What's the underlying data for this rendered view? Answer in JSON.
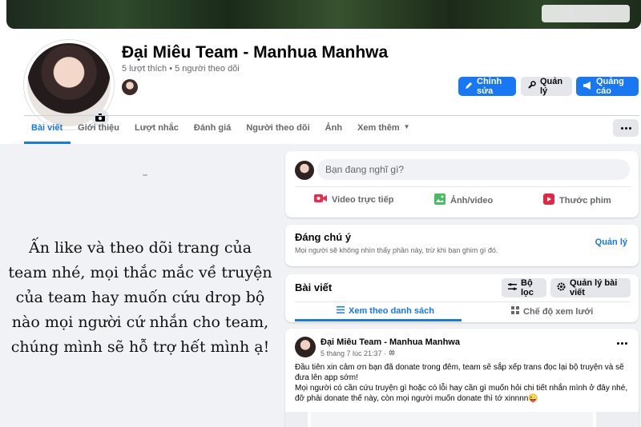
{
  "page": {
    "name": "Đại Miêu Team - Manhua Manhwa",
    "stats": "5 lượt thích • 5 người theo dõi"
  },
  "header_buttons": {
    "edit": "Chỉnh sửa",
    "manage": "Quản lý",
    "ads": "Quảng cáo"
  },
  "tabs": [
    "Bài viết",
    "Giới thiệu",
    "Lượt nhắc",
    "Đánh giá",
    "Người theo dõi",
    "Ảnh",
    "Xem thêm"
  ],
  "left_message": "Ấn like và theo dõi trang của team nhé, mọi thắc mắc về truyện của team hay muốn cứu drop bộ nào mọi người cứ nhắn cho team, chúng mình sẽ hỗ trợ hết mình ạ!",
  "composer": {
    "placeholder": "Bạn đang nghĩ gì?",
    "actions": [
      "Video trực tiếp",
      "Ảnh/video",
      "Thước phim"
    ]
  },
  "pinned": {
    "title": "Đáng chú ý",
    "subtitle": "Mọi người sẽ không nhìn thấy phần này, trừ khi bạn ghim gì đó.",
    "link": "Quản lý"
  },
  "posts_section": {
    "title": "Bài viết",
    "filter": "Bộ lọc",
    "manage": "Quản lý bài viết",
    "view_list": "Xem theo danh sách",
    "view_grid": "Chế độ xem lưới"
  },
  "post": {
    "author": "Đại Miêu Team - Manhua Manhwa",
    "time": "5 tháng 7 lúc 21:37 ·",
    "body": "Đầu tiên xin cảm ơn bạn đã donate trong đêm, team sẽ sắp xếp trans đọc lại bộ truyện và sẽ đưa lên app sớm!\nMọi người có cần cứu truyện gì hoặc có lỗi hay cần gì muốn hỏi chi tiết nhắn mình ở đây nhé, đỡ phải donate thế này, còn mọi người muốn donate thì tớ xinnnn😜"
  },
  "colors": {
    "accent": "#1877f2",
    "background": "#f0f2f5",
    "secondary_text": "#65676b"
  },
  "icons": {
    "live": "video-camera-icon",
    "photo": "photo-icon",
    "reel": "reel-icon",
    "edit": "pencil-icon",
    "manage": "wrench-icon",
    "ads": "megaphone-icon"
  }
}
